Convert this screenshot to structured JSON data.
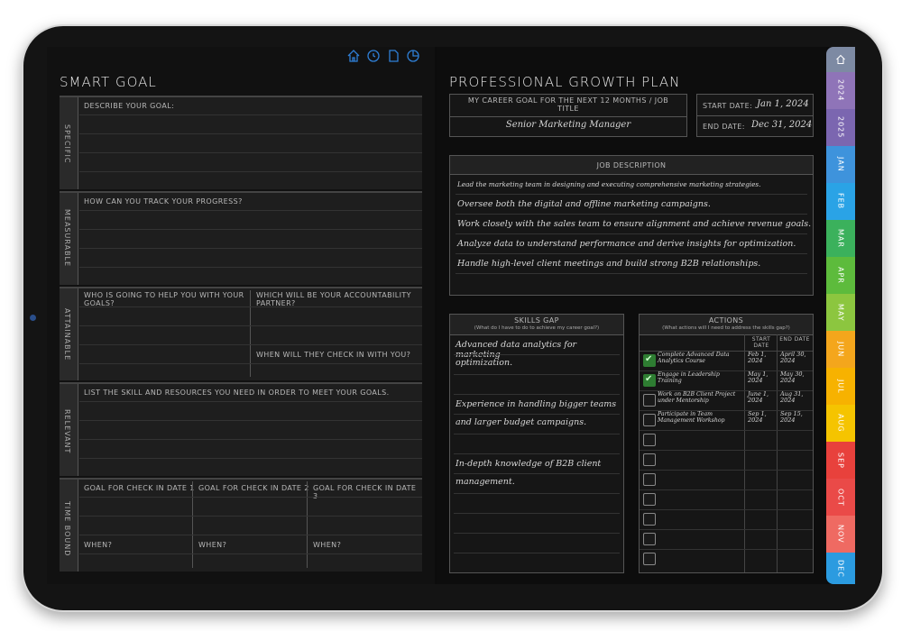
{
  "toolbar": {
    "icons": [
      "home-icon",
      "refresh-icon",
      "document-icon",
      "pie-chart-icon"
    ]
  },
  "smart": {
    "title": "SMART GOAL",
    "specific": {
      "label": "SPECIFIC",
      "prompt": "DESCRIBE YOUR GOAL:"
    },
    "measurable": {
      "label": "MEASURABLE",
      "prompt": "HOW CAN YOU TRACK YOUR PROGRESS?"
    },
    "attainable": {
      "label": "ATTAINABLE",
      "prompt_left": "WHO IS GOING TO HELP YOU WITH YOUR GOALS?",
      "prompt_right": "WHICH WILL BE YOUR ACCOUNTABILITY PARTNER?",
      "prompt_checkin": "WHEN WILL THEY CHECK IN WITH YOU?"
    },
    "relevant": {
      "label": "RELEVANT",
      "prompt": "LIST THE SKILL AND RESOURCES YOU NEED IN ORDER TO MEET YOUR GOALS."
    },
    "timebound": {
      "label": "TIME BOUND",
      "cols": [
        "GOAL FOR CHECK IN DATE 1",
        "GOAL FOR CHECK IN DATE 2",
        "GOAL FOR CHECK IN DATE 3"
      ],
      "when": "WHEN?"
    }
  },
  "growth": {
    "title": "PROFESSIONAL GROWTH PLAN",
    "career_header": "MY CAREER GOAL FOR THE NEXT 12 MONTHS / JOB TITLE",
    "career_value": "Senior Marketing Manager",
    "start_label": "START DATE:",
    "start_value": "Jan 1, 2024",
    "end_label": "END DATE:",
    "end_value": "Dec 31, 2024",
    "job_header": "JOB DESCRIPTION",
    "job_lines": [
      "Lead the marketing team in designing and executing comprehensive marketing strategies.",
      "Oversee both the digital and offline marketing campaigns.",
      "Work closely with the sales team to ensure alignment and achieve revenue goals.",
      "Analyze data to understand performance and derive insights for optimization.",
      "Handle high-level client meetings and build strong B2B relationships."
    ],
    "skills_header": "SKILLS GAP",
    "skills_sub": "(What do I have to do to achieve my career goal?)",
    "skills_lines": [
      "Advanced data analytics for marketing",
      "optimization.",
      "",
      "Experience in handling bigger teams",
      "and larger budget campaigns.",
      "",
      "In-depth knowledge of B2B client",
      "management."
    ],
    "actions_header": "ACTIONS",
    "actions_sub": "(What actions will I need to address the skills gap?)",
    "start_col": "START DATE",
    "end_col": "END DATE",
    "actions": [
      {
        "text": "Complete Advanced Data Analytics Course",
        "start": "Feb 1, 2024",
        "end": "April 30, 2024",
        "checked": true
      },
      {
        "text": "Engage in Leadership Training",
        "start": "May 1, 2024",
        "end": "May 30, 2024",
        "checked": true
      },
      {
        "text": "Work on B2B Client Project under Mentorship",
        "start": "June 1, 2024",
        "end": "Aug 31, 2024",
        "checked": false
      },
      {
        "text": "Participate in Team Management Workshop",
        "start": "Sep 1, 2024",
        "end": "Sep 15, 2024",
        "checked": false
      }
    ]
  },
  "tabs": [
    {
      "label": "",
      "color": "#7d8aa3",
      "icon": "home-icon"
    },
    {
      "label": "2024",
      "color": "#8f74b8"
    },
    {
      "label": "2025",
      "color": "#7b66b0"
    },
    {
      "label": "JAN",
      "color": "#3e93dc"
    },
    {
      "label": "FEB",
      "color": "#2aa3e6"
    },
    {
      "label": "MAR",
      "color": "#3bb15c"
    },
    {
      "label": "APR",
      "color": "#5dbb3c"
    },
    {
      "label": "MAY",
      "color": "#8cc63f"
    },
    {
      "label": "JUN",
      "color": "#f4a61c"
    },
    {
      "label": "JUL",
      "color": "#f7b200"
    },
    {
      "label": "AUG",
      "color": "#f5c400"
    },
    {
      "label": "SEP",
      "color": "#e8413c"
    },
    {
      "label": "OCT",
      "color": "#ea4a48"
    },
    {
      "label": "NOV",
      "color": "#ef6a62"
    },
    {
      "label": "DEC",
      "color": "#2b9be0"
    }
  ]
}
